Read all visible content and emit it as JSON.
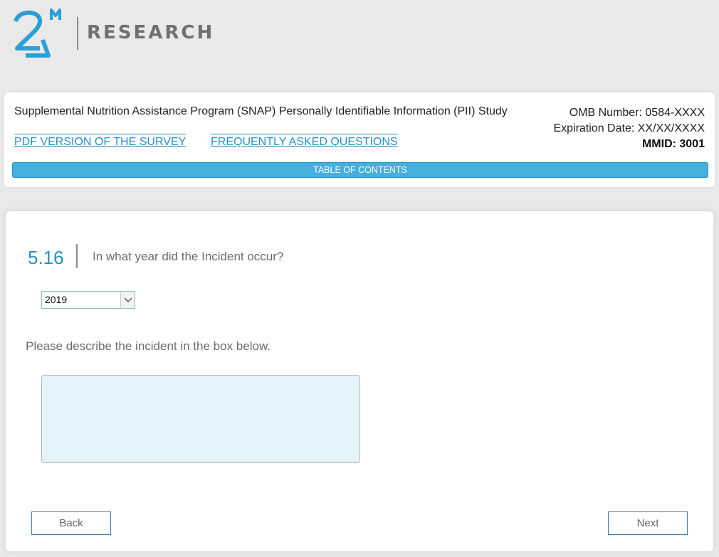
{
  "logo": {
    "mark_text": "2M",
    "wordmark": "RESEARCH",
    "brand_color": "#2a9fd6"
  },
  "header": {
    "study_title": "Supplemental Nutrition Assistance Program (SNAP) Personally Identifiable Information (PII) Study",
    "links": {
      "pdf": "PDF VERSION OF THE SURVEY",
      "faq": "FREQUENTLY ASKED QUESTIONS"
    },
    "omb_number": "OMB Number: 0584-XXXX",
    "expiration": "Expiration Date: XX/XX/XXXX",
    "mmid": "MMID: 3001",
    "toc_label": "TABLE OF CONTENTS"
  },
  "question": {
    "number": "5.16",
    "text": "In what year did the Incident occur?",
    "year_selected": "2019",
    "describe_prompt": "Please describe the incident in the box below.",
    "description_value": ""
  },
  "nav": {
    "back_label": "Back",
    "next_label": "Next"
  },
  "colors": {
    "accent": "#2a8fc4",
    "toc_bar": "#45b0dd",
    "textarea_bg": "#e4f3f9",
    "page_bg": "#e9e9e9"
  },
  "icons": {
    "select_arrow": "chevron-down-icon"
  }
}
